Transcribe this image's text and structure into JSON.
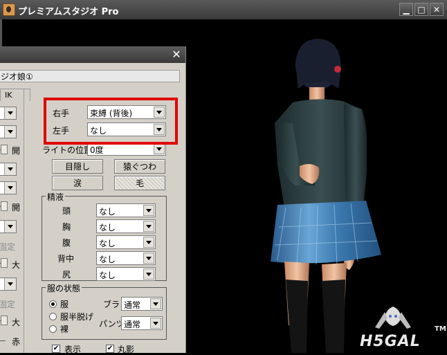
{
  "window": {
    "title": "プレミアムスタジオ Pro",
    "minimize_glyph": "▁",
    "maximize_glyph": "□",
    "close_glyph": "✕"
  },
  "panel": {
    "close_glyph": "✕",
    "model_name": "ジオ娘①",
    "tab_label": "IK"
  },
  "left_column": {
    "labels": [
      "開",
      "開",
      "固定",
      "大",
      "固定",
      "大",
      "赤"
    ]
  },
  "hands": {
    "right_label": "右手",
    "right_value": "束縛 (背後)",
    "left_label": "左手",
    "left_value": "なし"
  },
  "light_position": {
    "label": "ライトの位置",
    "value": "0度"
  },
  "buttons": {
    "blindfold": "目隠し",
    "gag": "猿ぐつわ",
    "tears": "涙",
    "hair": "毛"
  },
  "fluid_group": {
    "title": "精液",
    "rows": [
      {
        "label": "頭",
        "value": "なし"
      },
      {
        "label": "胸",
        "value": "なし"
      },
      {
        "label": "腹",
        "value": "なし"
      },
      {
        "label": "背中",
        "value": "なし"
      },
      {
        "label": "尻",
        "value": "なし"
      }
    ]
  },
  "clothing_group": {
    "title": "服の状態",
    "options": [
      "服",
      "服半脱げ",
      "裸"
    ],
    "selected": "服",
    "bra_label": "ブラ",
    "bra_value": "通常",
    "pants_label": "パンツ",
    "pants_value": "通常"
  },
  "checkboxes": [
    {
      "label": "表示",
      "checked": true
    },
    {
      "label": "丸影",
      "checked": true
    }
  ],
  "logo": {
    "text": "H5GAL",
    "tm": "TM"
  },
  "colors": {
    "highlight": "#e00000",
    "panel_bg": "#d4d0c8",
    "viewport_bg": "#000000"
  }
}
